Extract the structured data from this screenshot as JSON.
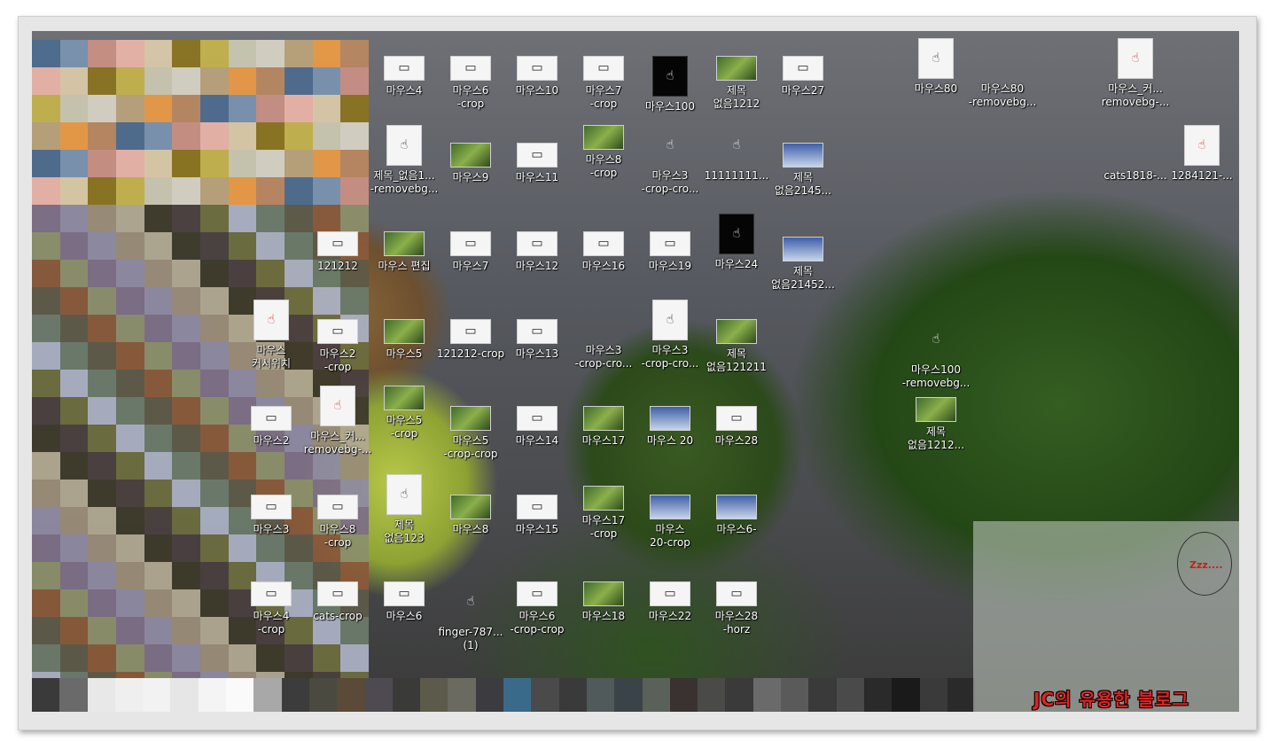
{
  "desktop_icons": [
    {
      "label": "마우스4",
      "thumb": "screen"
    },
    {
      "label": "마우스6\n-crop",
      "thumb": "screen"
    },
    {
      "label": "마우스10",
      "thumb": "screen"
    },
    {
      "label": "마우스7\n-crop",
      "thumb": "screen"
    },
    {
      "label": "마우스100",
      "thumb": "dark"
    },
    {
      "label": "제목\n없음1212",
      "thumb": "photo"
    },
    {
      "label": "마우스27",
      "thumb": "screen"
    },
    {
      "label": "마우스80",
      "thumb": "hand"
    },
    {
      "label": "마우스80\n-removebg...",
      "thumb": "none"
    },
    {
      "label": "마우스_커...\nremovebg-...",
      "thumb": "cursor"
    },
    {
      "label": "제목_없음1...\n-removebg...",
      "thumb": "hand"
    },
    {
      "label": "마우스9",
      "thumb": "photo"
    },
    {
      "label": "마우스11",
      "thumb": "screen"
    },
    {
      "label": "마우스8\n-crop",
      "thumb": "photo"
    },
    {
      "label": "마우스3\n-crop-cro...",
      "thumb": "hand-none"
    },
    {
      "label": "11111111...",
      "thumb": "hand-none"
    },
    {
      "label": "제목\n없음2145...",
      "thumb": "blue"
    },
    {
      "label": "cats1818-...",
      "thumb": "none"
    },
    {
      "label": "1284121-...",
      "thumb": "cursor"
    },
    {
      "label": "121212",
      "thumb": "screen"
    },
    {
      "label": "마우스 편집",
      "thumb": "photo"
    },
    {
      "label": "마우스7",
      "thumb": "screen"
    },
    {
      "label": "마우스12",
      "thumb": "screen"
    },
    {
      "label": "마우스16",
      "thumb": "screen"
    },
    {
      "label": "마우스19",
      "thumb": "screen"
    },
    {
      "label": "마우스24",
      "thumb": "dark"
    },
    {
      "label": "제목\n없음21452...",
      "thumb": "blue"
    },
    {
      "label": "마우스\n커서위치",
      "thumb": "cursor"
    },
    {
      "label": "마우스2\n-crop",
      "thumb": "screen"
    },
    {
      "label": "마우스5",
      "thumb": "photo"
    },
    {
      "label": "121212-crop",
      "thumb": "screen"
    },
    {
      "label": "마우스13",
      "thumb": "screen"
    },
    {
      "label": "마우스3\n-crop-cro...",
      "thumb": "none"
    },
    {
      "label": "마우스3\n-crop-cro...",
      "thumb": "hand"
    },
    {
      "label": "제목\n없음121211",
      "thumb": "photo"
    },
    {
      "label": "마우스100\n-removebg...",
      "thumb": "hand-none"
    },
    {
      "label": "마우스2",
      "thumb": "screen"
    },
    {
      "label": "마우스_커...\nremovebg-...",
      "thumb": "cursor"
    },
    {
      "label": "마우스5\n-crop",
      "thumb": "photo"
    },
    {
      "label": "마우스5\n-crop-crop",
      "thumb": "photo"
    },
    {
      "label": "마우스14",
      "thumb": "screen"
    },
    {
      "label": "마우스17",
      "thumb": "photo"
    },
    {
      "label": "마우스 20",
      "thumb": "blue"
    },
    {
      "label": "마우스28",
      "thumb": "screen"
    },
    {
      "label": "제목\n없음1212...",
      "thumb": "photo"
    },
    {
      "label": "마우스3",
      "thumb": "screen"
    },
    {
      "label": "마우스8\n-crop",
      "thumb": "screen"
    },
    {
      "label": "제목\n없음123",
      "thumb": "hand"
    },
    {
      "label": "마우스8",
      "thumb": "photo"
    },
    {
      "label": "마우스15",
      "thumb": "screen"
    },
    {
      "label": "마우스17\n-crop",
      "thumb": "photo"
    },
    {
      "label": "마우스\n20-crop",
      "thumb": "blue"
    },
    {
      "label": "마우스6-",
      "thumb": "blue"
    },
    {
      "label": "마우스4\n-crop",
      "thumb": "screen"
    },
    {
      "label": "cats-crop",
      "thumb": "screen"
    },
    {
      "label": "마우스6",
      "thumb": "screen"
    },
    {
      "label": "finger-787...\n(1)",
      "thumb": "hand-none"
    },
    {
      "label": "마우스6\n-crop-crop",
      "thumb": "screen"
    },
    {
      "label": "마우스18",
      "thumb": "photo"
    },
    {
      "label": "마우스22",
      "thumb": "screen"
    },
    {
      "label": "마우스28\n-horz",
      "thumb": "screen"
    }
  ],
  "overlay": {
    "zzz_text": "Zzz....",
    "blog_watermark": "JC의 유용한 블로그"
  },
  "colors": {
    "pixel_block": [
      "#4d6b8e",
      "#7a92b0",
      "#c98f84",
      "#e9b3a8",
      "#d9c9a8",
      "#8a7420",
      "#c4b24c",
      "#c9c7b0",
      "#d6d2c4",
      "#b9a27a",
      "#e89a44",
      "#b88760"
    ]
  }
}
